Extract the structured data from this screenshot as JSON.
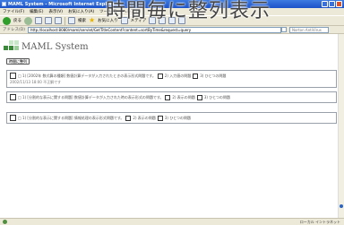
{
  "window": {
    "title": "MAML System - Microsoft Internet Explorer",
    "menu": [
      "ファイル(F)",
      "編集(E)",
      "表示(V)",
      "お気に入り(A)",
      "ツール(T)",
      "ヘルプ(H)"
    ]
  },
  "toolbar": {
    "back_label": "戻る",
    "search_label": "検索",
    "favorites_label": "お気に入り",
    "media_label": "メディア"
  },
  "address": {
    "label": "アドレス(D)",
    "url": "http://localhost:8080/maml/servlet/GetTitleContent?content=sortByTime&request=query"
  },
  "search": {
    "placeholder": "Norton AntiVirus"
  },
  "overlay": {
    "caption": "時間毎に整列表示"
  },
  "logo": {
    "name": "MAML System",
    "colors": [
      "#3a8a3a",
      "#9acd9a",
      "#c8e6c8"
    ]
  },
  "main_button": {
    "label": "時間に整列"
  },
  "items": [
    {
      "line1": "□ 1) [2002年 数式算の種類] 数値計算データが入力されたときの表示形式問題です。",
      "opt1": "2) 入力値の問題",
      "opt2": "3) ひとつの問題",
      "line2": "2002/11/13 18:00  不正解です"
    },
    {
      "line1": "□ 1) [分割的な表示に関する問題] 数値計算データが入力された時の表示形式の問題です。",
      "opt1": "2) 表示の問題",
      "opt2": "3) ひとつの問題"
    },
    {
      "line1": "□ 1) [分割的な表示に関する問題] 情報処理の表示形式問題です。",
      "opt1": "2) 表示の問題",
      "opt2": "3) ひとつの問題"
    }
  ],
  "status": {
    "zone": "ローカル イントラネット"
  }
}
